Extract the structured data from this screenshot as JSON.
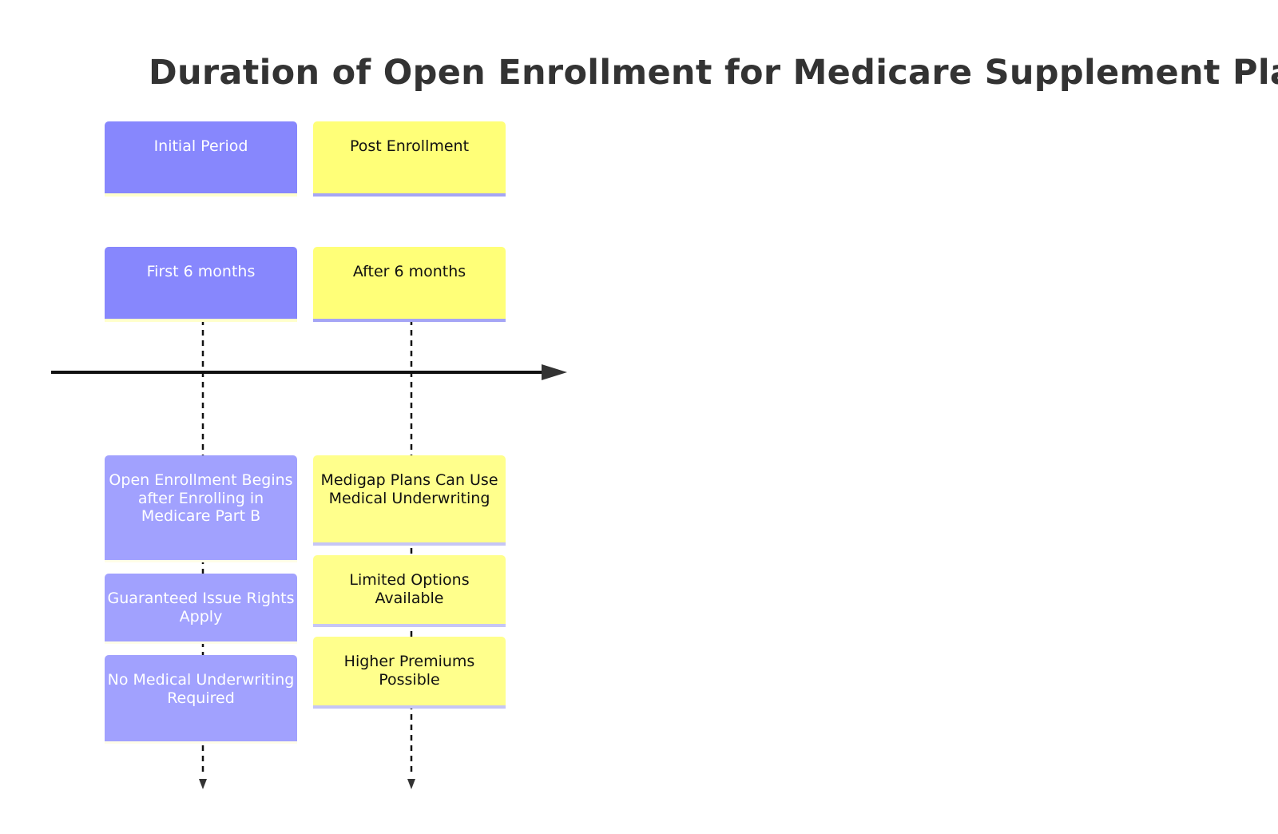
{
  "title": "Duration of Open Enrollment for Medicare Supplement Plans",
  "colors": {
    "period_primary": "#8787fd",
    "period_secondary": "#ffff78",
    "event_primary": "#a1a1fe",
    "event_secondary": "#ffff8c",
    "axis": "#111111"
  },
  "sections": [
    {
      "section_label": "Initial Period",
      "period_label": "First 6 months",
      "events": [
        "Open Enrollment Begins after Enrolling in Medicare Part B",
        "Guaranteed Issue Rights Apply",
        "No Medical Underwriting Required"
      ]
    },
    {
      "section_label": "Post Enrollment",
      "period_label": "After 6 months",
      "events": [
        "Medigap Plans Can Use Medical Underwriting",
        "Limited Options Available",
        "Higher Premiums Possible"
      ]
    }
  ]
}
